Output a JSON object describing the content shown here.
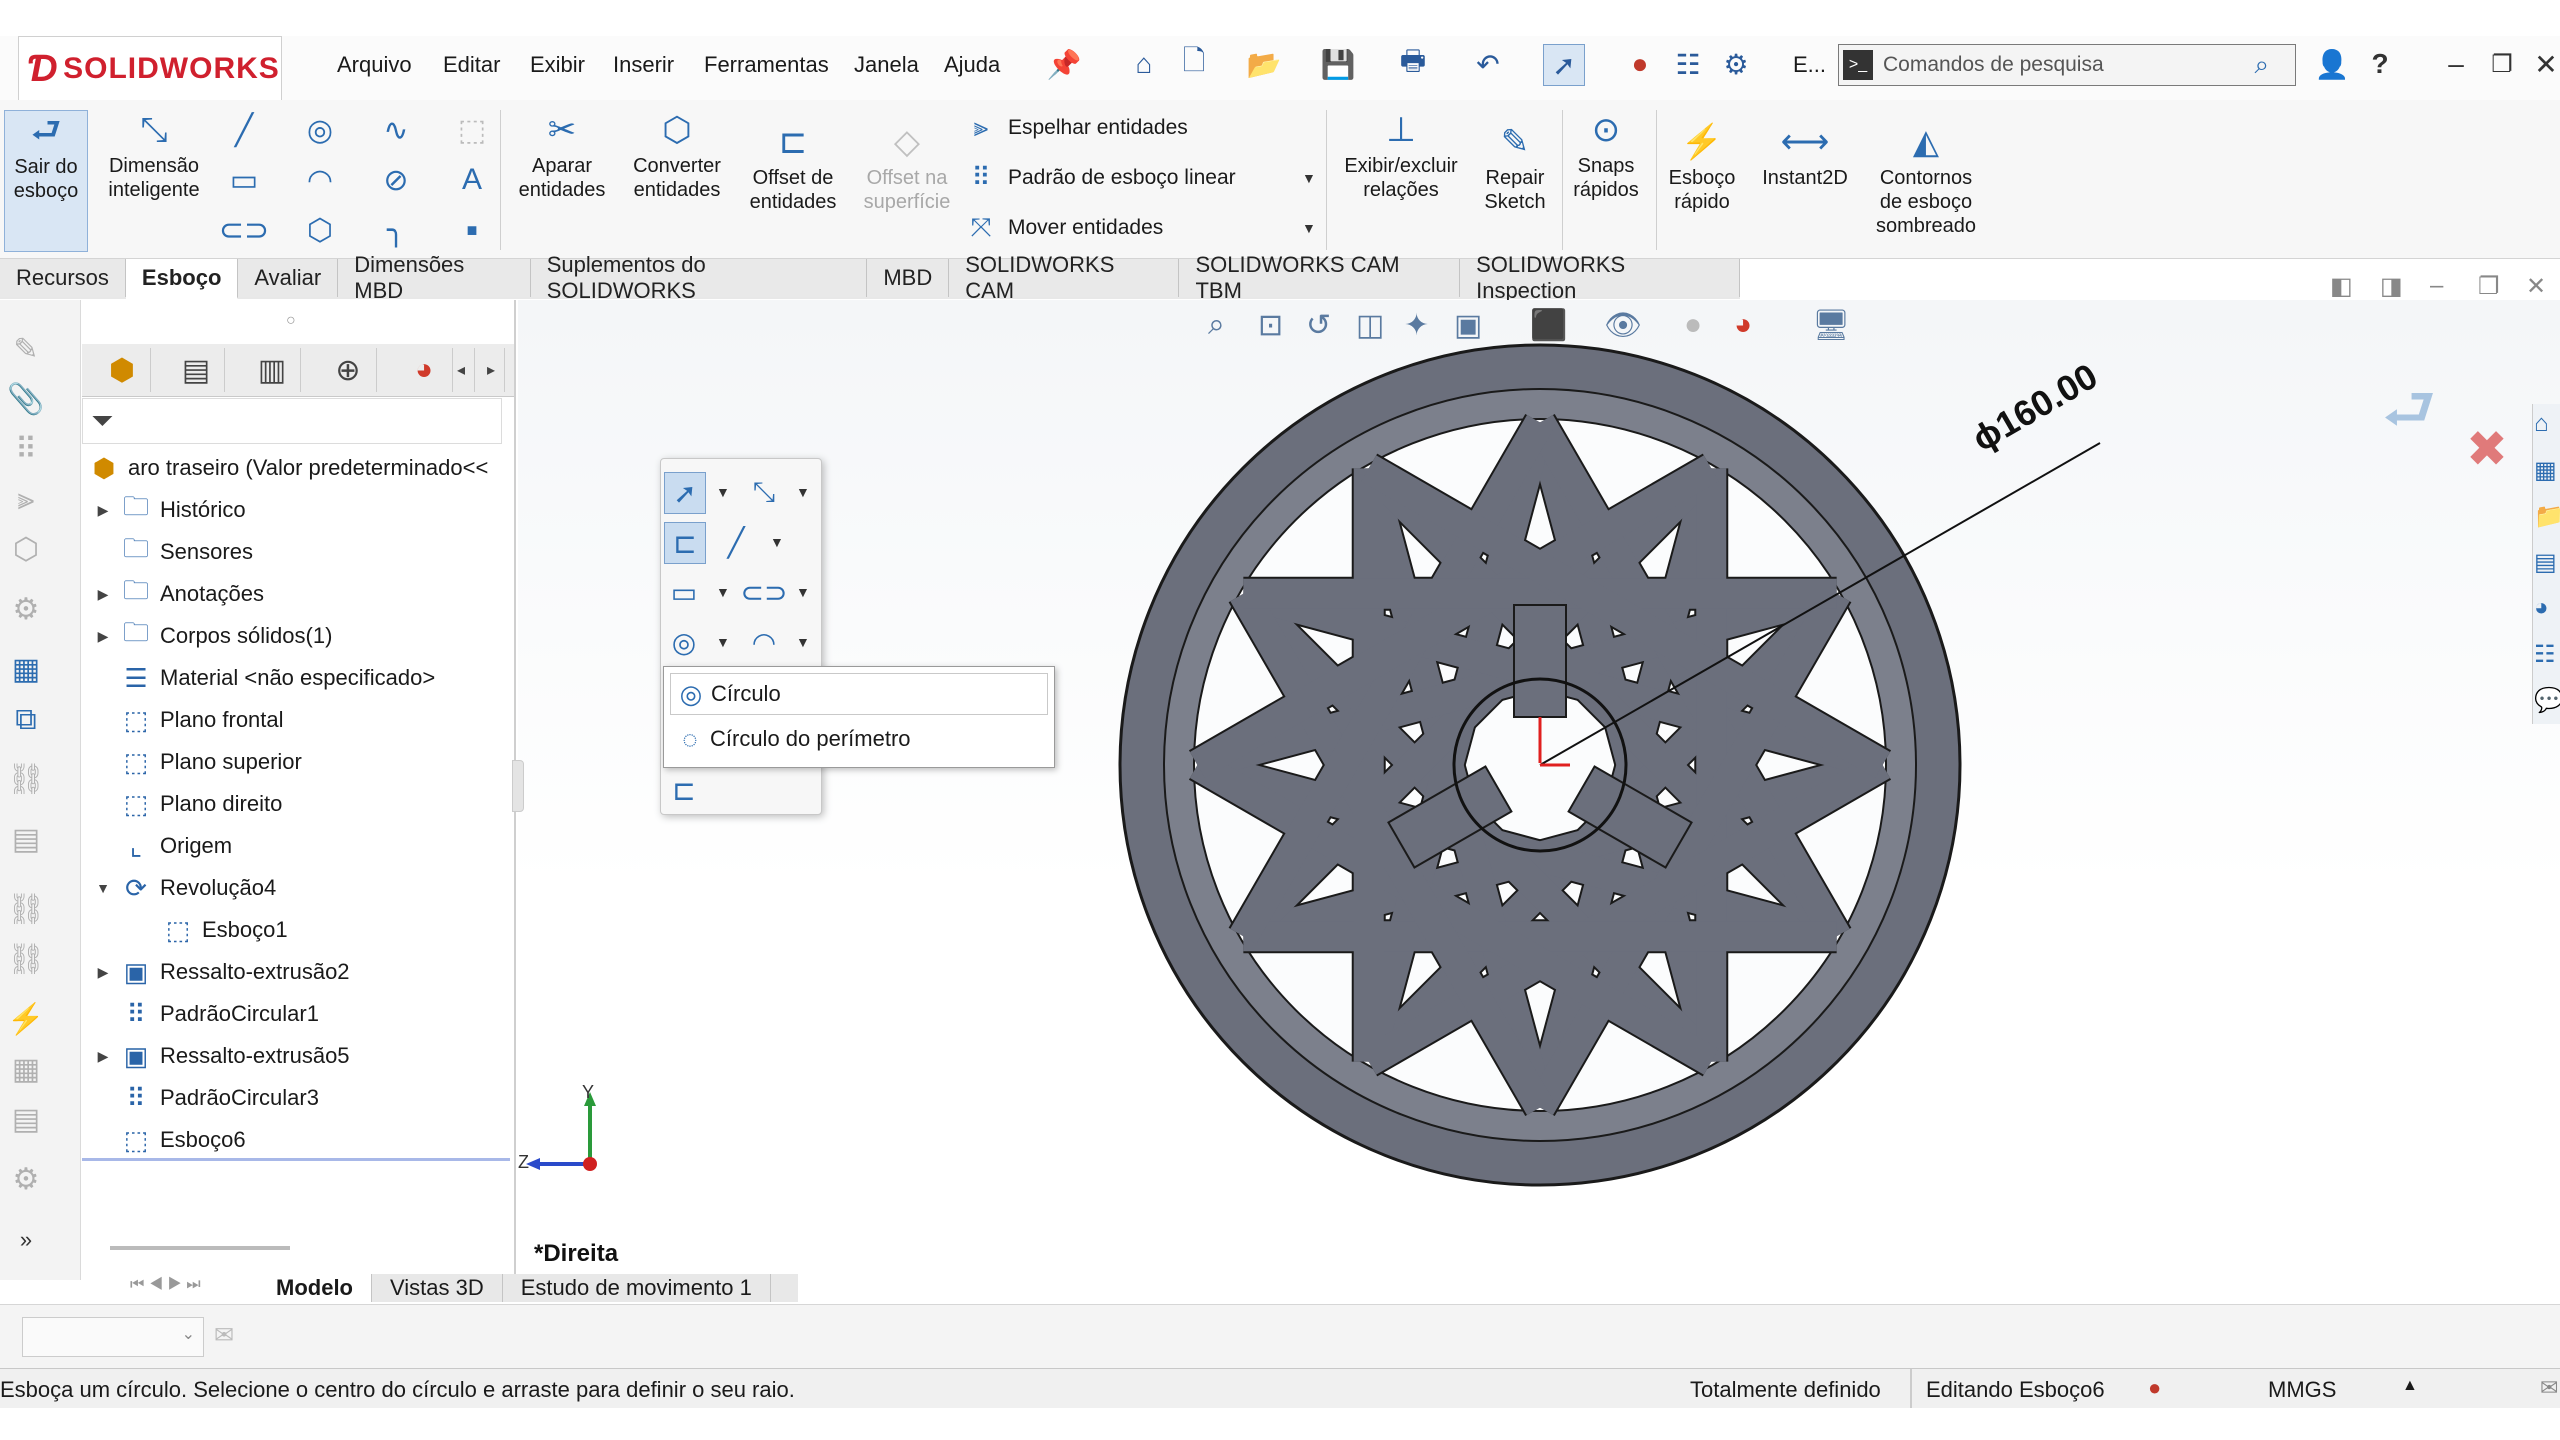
{
  "app": {
    "logo_brand": "DS SOLIDWORKS",
    "brand_color": "#d0202e",
    "accent_color": "#2c6cb0"
  },
  "menu": [
    "Arquivo",
    "Editar",
    "Exibir",
    "Inserir",
    "Ferramentas",
    "Janela",
    "Ajuda"
  ],
  "toolbar": {
    "overflow_label": "E...",
    "search_placeholder": "Comandos de pesquisa",
    "icons": [
      "pin-icon",
      "home-icon",
      "new-document-icon",
      "open-icon",
      "save-icon",
      "print-icon",
      "undo-icon",
      "select-icon",
      "traffic-light-icon",
      "file-properties-icon",
      "options-icon"
    ],
    "help_label": "?"
  },
  "command_manager": {
    "exit_sketch": "Sair do\nesboço",
    "smart_dimension": "Dimensão\ninteligente",
    "trim": "Aparar\nentidades",
    "convert": "Converter\nentidades",
    "offset": "Offset de\nentidades",
    "offset_surface": "Offset na\nsuperfície",
    "mirror": "Espelhar entidades",
    "linear_pattern": "Padrão de esboço linear",
    "move": "Mover entidades",
    "display_relations": "Exibir/excluir\nrelações",
    "repair_sketch": "Repair\nSketch",
    "quick_snaps": "Snaps\nrápidos",
    "rapid_sketch": "Esboço\nrápido",
    "instant2d": "Instant2D",
    "shaded_contours": "Contornos\nde esboço\nsombreado"
  },
  "tabs": [
    "Recursos",
    "Esboço",
    "Avaliar",
    "Dimensões MBD",
    "Suplementos do SOLIDWORKS",
    "MBD",
    "SOLIDWORKS CAM",
    "SOLIDWORKS CAM TBM",
    "SOLIDWORKS Inspection"
  ],
  "active_tab": "Esboço",
  "feature_tree": {
    "root": "aro traseiro  (Valor predeterminado<<",
    "items": [
      {
        "label": "Histórico",
        "icon": "history-folder-icon",
        "expandable": true
      },
      {
        "label": "Sensores",
        "icon": "sensors-folder-icon",
        "expandable": false
      },
      {
        "label": "Anotações",
        "icon": "annotations-folder-icon",
        "expandable": true
      },
      {
        "label": "Corpos sólidos(1)",
        "icon": "solid-bodies-folder-icon",
        "expandable": true
      },
      {
        "label": "Material <não especificado>",
        "icon": "material-icon",
        "expandable": false
      },
      {
        "label": "Plano frontal",
        "icon": "plane-icon",
        "expandable": false
      },
      {
        "label": "Plano superior",
        "icon": "plane-icon",
        "expandable": false
      },
      {
        "label": "Plano direito",
        "icon": "plane-icon",
        "expandable": false
      },
      {
        "label": "Origem",
        "icon": "origin-icon",
        "expandable": false
      },
      {
        "label": "Revolução4",
        "icon": "revolve-icon",
        "expandable": true,
        "expanded": true
      },
      {
        "label": "Esboço1",
        "icon": "sketch-icon",
        "expandable": false,
        "indent": true
      },
      {
        "label": "Ressalto-extrusão2",
        "icon": "extrude-icon",
        "expandable": true
      },
      {
        "label": "PadrãoCircular1",
        "icon": "circular-pattern-icon",
        "expandable": false
      },
      {
        "label": "Ressalto-extrusão5",
        "icon": "extrude-icon",
        "expandable": true
      },
      {
        "label": "PadrãoCircular3",
        "icon": "circular-pattern-icon",
        "expandable": false
      },
      {
        "label": "Esboço6",
        "icon": "sketch-icon",
        "expandable": false
      }
    ]
  },
  "popup": {
    "flyout_items": [
      "Círculo",
      "Círculo do perímetro"
    ]
  },
  "viewport": {
    "dimension_label": "ϕ160.00",
    "view_name": "*Direita",
    "axis_y": "Y",
    "axis_z": "Z"
  },
  "model_tabs": [
    "Modelo",
    "Vistas 3D",
    "Estudo de movimento 1"
  ],
  "status": {
    "message": "Esboça um círculo. Selecione o centro do círculo e arraste para definir o seu raio.",
    "definition": "Totalmente definido",
    "editing": "Editando Esboço6",
    "units": "MMGS"
  }
}
